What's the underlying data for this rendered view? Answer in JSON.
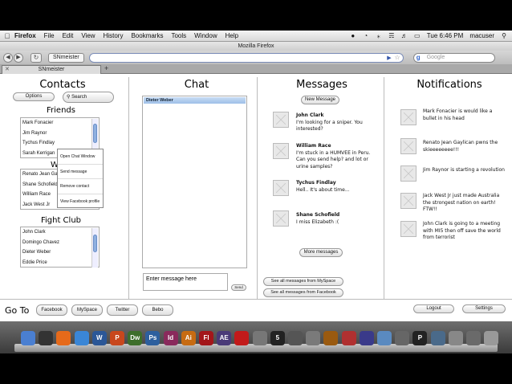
{
  "menubar": {
    "app": "Firefox",
    "items": [
      "File",
      "Edit",
      "View",
      "History",
      "Bookmarks",
      "Tools",
      "Window",
      "Help"
    ],
    "clock": "Tue 6:46 PM",
    "user": "macuser"
  },
  "window": {
    "title": "Mozilla Firefox"
  },
  "toolbar": {
    "site_button": "SNmeister",
    "search_placeholder": "Google"
  },
  "tab": {
    "label": "SNmeister"
  },
  "contacts": {
    "heading": "Contacts",
    "options_label": "Options",
    "search_label": "Search",
    "friends_heading": "Friends",
    "friends": [
      "Mark Fonacier",
      "Jim Raynor",
      "Tychus Findlay",
      "Sarah Kerrigan"
    ],
    "work_heading": "W",
    "work": [
      "Renato Jean Gay",
      "Shane Schofield",
      "William Race",
      "Jack West Jr"
    ],
    "fightclub_heading": "Fight Club",
    "fightclub": [
      "John Clark",
      "Domingo Chavez",
      "Dieter Weber",
      "Eddie Price"
    ]
  },
  "context_menu": [
    "Open Chat Window",
    "Send message",
    "Remove contact",
    "View Facebook profile"
  ],
  "chat": {
    "heading": "Chat",
    "active_contact": "Dieter Weber",
    "input_placeholder": "Enter message here",
    "send_label": "Send"
  },
  "messages": {
    "heading": "Messages",
    "new_label": "New Message",
    "items": [
      {
        "from": "John Clark",
        "text": "I'm looking for a sniper. You interested?"
      },
      {
        "from": "William Race",
        "text": "I'm stuck in a HUMVEE in Peru. Can you send help? and lot or urine samples?"
      },
      {
        "from": "Tychus Findlay",
        "text": "Hell.. It's about time..."
      },
      {
        "from": "Shane Schofield",
        "text": "I miss Elizabeth :("
      }
    ],
    "more_label": "More messages",
    "myspace_label": "See all messages from MySpace",
    "facebook_label": "See all messages from Facebook"
  },
  "notifications": {
    "heading": "Notifications",
    "items": [
      "Mark Fonacier is would like a bullet in his head",
      "Renato Jean Gaylican pwns the skieeeeeeee!!!",
      "Jim Raynor is starting a revolution",
      "Jack West Jr just made Australia the strongest nation on earth! FTW!!",
      "John Clark is going to a meeting with MI5 then off save the world from terrorist"
    ]
  },
  "goto": {
    "label": "Go To",
    "links": [
      "Facebook",
      "MySpace",
      "Twitter",
      "Bebo"
    ],
    "logout_label": "Logout",
    "settings_label": "Settings"
  },
  "dock": {
    "icons": [
      "finder-icon",
      "dashboard-icon",
      "firefox-icon",
      "safari-icon",
      "word-icon",
      "powerpoint-icon",
      "dreamweaver-icon",
      "photoshop-icon",
      "indesign-icon",
      "illustrator-icon",
      "flash-icon",
      "aftereffects-icon",
      "acrobat-icon",
      "app-icon",
      "app-icon",
      "app-icon",
      "app-icon",
      "app-icon",
      "app-icon",
      "app-icon",
      "app-icon",
      "app-icon",
      "app-icon",
      "app-icon",
      "app-icon",
      "app-icon",
      "trash-icon"
    ],
    "labels": [
      "",
      "",
      "",
      "",
      "W",
      "P",
      "Dw",
      "Ps",
      "Id",
      "Ai",
      "Fl",
      "AE",
      "",
      "",
      "5",
      "",
      "",
      "",
      "",
      "",
      "",
      "",
      "P",
      "",
      "",
      "",
      ""
    ],
    "colors": [
      "#4a7fd1",
      "#333333",
      "#e66a1a",
      "#3a86d6",
      "#2b5797",
      "#c8471d",
      "#3d6e2b",
      "#2d5f9e",
      "#8a2a5c",
      "#c76b12",
      "#a3161a",
      "#4a3a78",
      "#c21a1a",
      "#777777",
      "#222222",
      "#555555",
      "#7a7a7a",
      "#9a5a10",
      "#b03030",
      "#3a3a8a",
      "#5a8ac0",
      "#666666",
      "#222222",
      "#4a6a8a",
      "#888888",
      "#6a6a6a",
      "#999999"
    ]
  }
}
